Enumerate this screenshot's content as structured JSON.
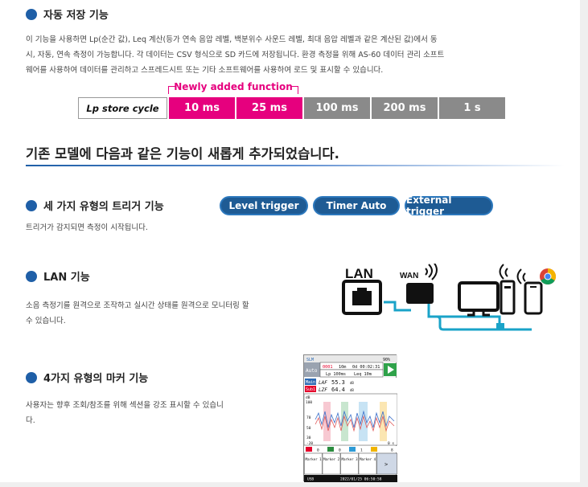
{
  "auto_save": {
    "title": "자동 저장 기능",
    "description_lines": [
      "이 기능을 사용하면 Lp(순간 값), Leq 계산(등가 연속 음압 레벨, 백분위수 사운드 레벨, 최대 음압 레벨과 같은 계산된 값)에서 동",
      "시, 자동, 연속 측정이 가능합니다. 각 데이터는 CSV 형식으로 SD 카드에 저장됩니다. 환경 측정을 위해 AS-60 데이터 관리 소프트",
      "웨어를 사용하여 데이터를 관리하고 스프레드시트 또는 기타 소프트웨어를 사용하여 로드 및 표시할 수 있습니다."
    ],
    "new_function_label": "Newly added function",
    "lp_label": "Lp store cycle",
    "cycles": [
      {
        "label": "10 ms",
        "new": true
      },
      {
        "label": "25 ms",
        "new": true
      },
      {
        "label": "100 ms",
        "new": false
      },
      {
        "label": "200 ms",
        "new": false
      },
      {
        "label": "1 s",
        "new": false
      }
    ]
  },
  "section_heading": "기존 모델에 다음과 같은 기능이 새롭게 추가되었습니다.",
  "trigger": {
    "title": "세 가지 유형의 트리거 기능",
    "description": "트리거가 감지되면 측정이 시작됩니다.",
    "pills": [
      "Level trigger",
      "Timer Auto",
      "External trigger"
    ]
  },
  "lan": {
    "title": "LAN 기능",
    "description_lines": [
      "소음 측정기를 원격으로 조작하고 실시간 상태를 원격으로 모니터링 할",
      "수 있습니다."
    ],
    "diagram": {
      "lan_label": "LAN",
      "wan_label": "WAN"
    }
  },
  "marker": {
    "title": "4가지 유형의 마커 기능",
    "description_lines": [
      "사용자는 향후 조회/참조를 위해 섹션을 강조 표시할 수 있습니",
      "다."
    ],
    "device": {
      "top_left": "SLM",
      "battery": "90%",
      "row1": [
        "0001",
        "10m",
        "0d 00:02:31"
      ],
      "row2": [
        "Lp 100ms",
        "Leq 10m"
      ],
      "auto_label": "Auto",
      "main_tag": "Main",
      "main_name": "LAF",
      "main_value": "55.3",
      "sub_tag": "Sub1",
      "sub_name": "LZF",
      "sub_value": "64.4",
      "unit": "dB",
      "graph_unit": "dB",
      "y_ticks": [
        "100",
        "70",
        "50",
        "30"
      ],
      "x_left": "-20",
      "x_right": "0 s",
      "marker_counts": [
        "0",
        "0",
        "1",
        "0"
      ],
      "marker_right": "8",
      "marker_buttons": [
        "Marker 1",
        "Marker 2",
        "Marker 3",
        "Marker 4"
      ],
      "next_label": ">",
      "footer_usb": "USB",
      "footer_time": "2022/01/25 06:50:58",
      "marker_colors": [
        "#e4002b",
        "#2a8c3e",
        "#2e9bd6",
        "#f0b400"
      ]
    }
  },
  "colors": {
    "accent_blue": "#1f5fa7",
    "pink": "#e6007e",
    "grey_cell": "#8a8a8a",
    "pill": "#1e5b94",
    "cable": "#1aa3c8"
  }
}
